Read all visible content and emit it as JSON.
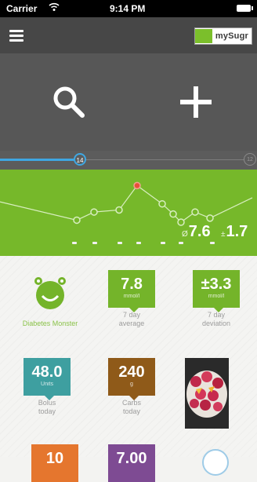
{
  "status_bar": {
    "carrier": "Carrier",
    "time": "9:14 PM"
  },
  "nav": {
    "logo_text": "mySugr"
  },
  "timeline": {
    "current_label": "14",
    "end_label": "12"
  },
  "chart_data": {
    "type": "line",
    "points": [
      {
        "x": 0,
        "y": 3.0
      },
      {
        "x": 1,
        "y": 2.1
      },
      {
        "x": 2,
        "y": 2.5
      },
      {
        "x": 3,
        "y": 2.6
      },
      {
        "x": 4,
        "y": 3.8,
        "highlight": true
      },
      {
        "x": 5,
        "y": 2.9
      },
      {
        "x": 6,
        "y": 2.4
      },
      {
        "x": 7,
        "y": 2.0
      },
      {
        "x": 8,
        "y": 2.5
      },
      {
        "x": 9,
        "y": 2.2
      },
      {
        "x": 10,
        "y": 3.2
      }
    ],
    "colors": {
      "line": "#d8eec0",
      "highlight": "#e8503a",
      "background": "#76b82a"
    }
  },
  "stats": {
    "average": "7.6",
    "deviation": "1.7",
    "avg_symbol": "Ø",
    "dev_symbol": "±"
  },
  "tiles": {
    "monster": {
      "caption": "Diabetes Monster"
    },
    "avg_7day": {
      "value": "7.8",
      "unit": "mmol/l",
      "caption1": "7 day",
      "caption2": "average"
    },
    "dev_7day": {
      "value": "±3.3",
      "unit": "mmol/l",
      "caption1": "7 day",
      "caption2": "deviation"
    },
    "bolus": {
      "value": "48.0",
      "unit": "Units",
      "caption1": "Bolus",
      "caption2": "today"
    },
    "carbs": {
      "value": "240",
      "unit": "g",
      "caption1": "Carbs",
      "caption2": "today"
    },
    "row3_left": {
      "value": "10"
    },
    "row3_mid": {
      "value": "7.00"
    }
  }
}
